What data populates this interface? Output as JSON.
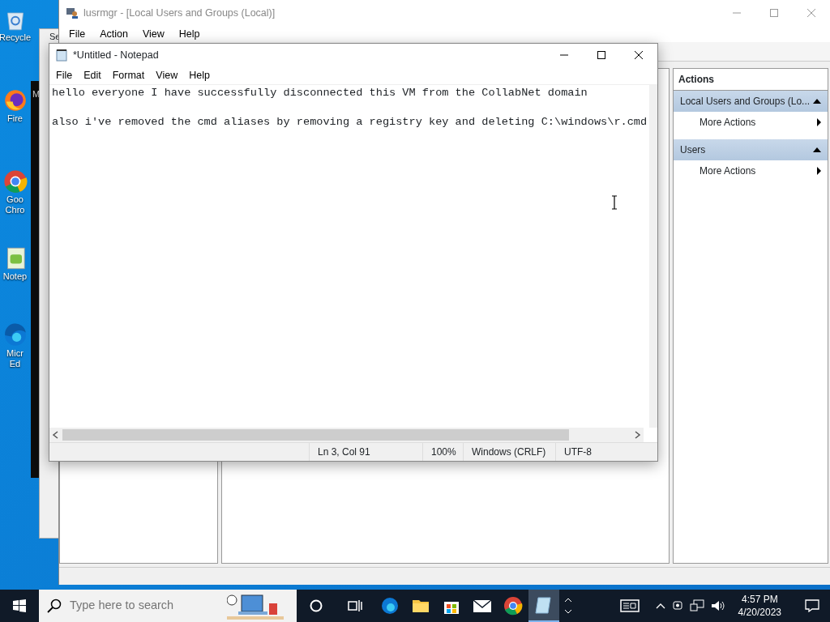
{
  "desktop_icons": [
    {
      "kind": "recycle",
      "lines": [
        "Recycle"
      ]
    },
    {
      "kind": "firefox",
      "lines": [
        "Fire"
      ]
    },
    {
      "kind": "chrome",
      "lines": [
        "Goo",
        "Chro"
      ]
    },
    {
      "kind": "notepad",
      "lines": [
        "Notep"
      ]
    },
    {
      "kind": "edge",
      "lines": [
        "Micr",
        "Ed"
      ]
    }
  ],
  "background_window": {
    "title": "Se"
  },
  "console_window": {
    "text": "M"
  },
  "lusrmgr": {
    "title": "lusrmgr - [Local Users and Groups (Local)]",
    "menu": [
      "File",
      "Action",
      "View",
      "Help"
    ],
    "actions": {
      "header": "Actions",
      "sections": [
        {
          "title": "Local Users and Groups (Lo...",
          "expanded": true,
          "items": [
            "More Actions"
          ]
        },
        {
          "title": "Users",
          "expanded": true,
          "items": [
            "More Actions"
          ]
        }
      ]
    }
  },
  "notepad": {
    "title": "*Untitled - Notepad",
    "menu": [
      "File",
      "Edit",
      "Format",
      "View",
      "Help"
    ],
    "paragraphs": [
      "hello everyone I have successfully disconnected this VM from the CollabNet domain",
      "also i've removed the cmd aliases by removing a registry key and deleting C:\\windows\\r.cmd"
    ],
    "status": [
      "Ln 3, Col 91",
      "100%",
      "Windows (CRLF)",
      "UTF-8"
    ]
  },
  "taskbar": {
    "search": {
      "placeholder": "Type here to search"
    },
    "apps": [
      {
        "kind": "edge",
        "selected": false
      },
      {
        "kind": "folder",
        "selected": false
      },
      {
        "kind": "store",
        "selected": false
      },
      {
        "kind": "mail",
        "selected": false
      },
      {
        "kind": "chrome",
        "selected": false
      },
      {
        "kind": "notepad",
        "selected": true
      }
    ],
    "time": "4:57 PM",
    "date": "4/20/2023"
  }
}
